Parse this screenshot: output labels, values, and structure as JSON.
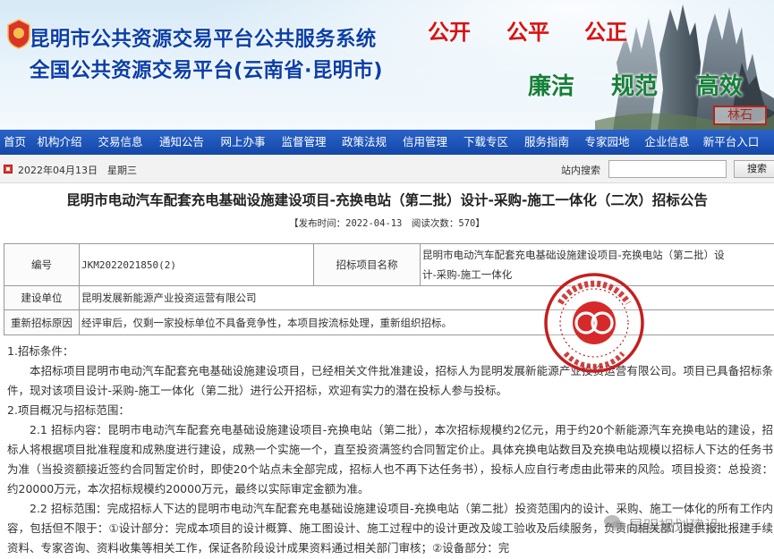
{
  "header": {
    "site_title_line1": "昆明市公共资源交易平台公共服务系统",
    "site_title_line2": "全国公共资源交易平台(云南省·昆明市)",
    "motto_top": [
      "公开",
      "公平",
      "公正"
    ],
    "motto_bottom": [
      "廉洁",
      "规范",
      "高效"
    ],
    "corner_seal": "林石"
  },
  "nav": {
    "items": [
      "首页",
      "机构介绍",
      "交易信息",
      "通知公告",
      "网上办事",
      "监督管理",
      "政策法规",
      "信用管理",
      "下载专区",
      "服务指南",
      "专家园地",
      "企业信息",
      "新平台入口"
    ]
  },
  "strip": {
    "date": "2022年04月13日　星期三",
    "search_label": "站内搜索",
    "search_button": "搜索",
    "search_value": ""
  },
  "document": {
    "title": "昆明市电动汽车配套充电基础设施建设项目-充换电站（第二批）设计-采购-施工一体化（二次）招标公告",
    "meta": "【发布时间：2022-04-13　阅读次数：570】"
  },
  "info_table": {
    "code_label": "编号",
    "code_value": "JKM2022021850(2)",
    "project_label": "招标项目名称",
    "project_value_line1": "昆明市电动汽车配套充电基础设施建设项目-充换电站（第二批）设",
    "project_value_line2": "计-采购-施工一体化",
    "unit_label": "建设单位",
    "unit_value": "昆明发展新能源产业投资运营有限公司",
    "reason_label": "重新招标原因",
    "reason_value": "经评审后，仅剩一家投标单位不具备竞争性，本项目按流标处理，重新组织招标。"
  },
  "content": {
    "s1_heading": "1.招标条件：",
    "s1_body": "本招标项目昆明市电动汽车配套充电基础设施建设项目，已经相关文件批准建设，招标人为昆明发展新能源产业投资运营有限公司。项目已具备招标条件，现对该项目设计-采购-施工一体化（第二批）进行公开招标，欢迎有实力的潜在投标人参与投标。",
    "s2_heading": "2.项目概况与招标范围：",
    "s2_1": "2.1 招标内容：昆明市电动汽车配套充电基础设施建设项目-充换电站（第二批），本次招标规模约2亿元，用于约20个新能源汽车充换电站的建设，招标人将根据项目批准程度和成熟度进行建设，成熟一个实施一个，直至投资满签约合同暂定价止。具体充换电站数目及充换电站规模以招标人下达的任务书为准（当投资额接近签约合同暂定价时，即使20个站点未全部完成，招标人也不再下达任务书），投标人应自行考虑由此带来的风险。项目投资：总投资：约20000万元，本次招标规模约20000万元，最终以实际审定金额为准。",
    "s2_2": "2.2 招标范围：完成招标人下达的昆明市电动汽车配套充电基础设施建设项目-充换电站（第二批）投资范围内的设计、采购、施工一体化的所有工作内容，包括但不限于：①设计部分：完成本项目的设计概算、施工图设计、施工过程中的设计更改及竣工验收及后续服务，负责向相关部门提供报批报建手续资料、专家咨询、资料收集等相关工作，保证各阶段设计成果资料通过相关部门审核；②设备部分：完"
  },
  "watermark": {
    "text": "昆明规划建设"
  },
  "colors": {
    "nav_blue": "#1a52b8",
    "title_blue": "#0b3fa8",
    "motto_red": "#d81212",
    "motto_green": "#15803a",
    "stamp_red": "#c41f1f"
  }
}
